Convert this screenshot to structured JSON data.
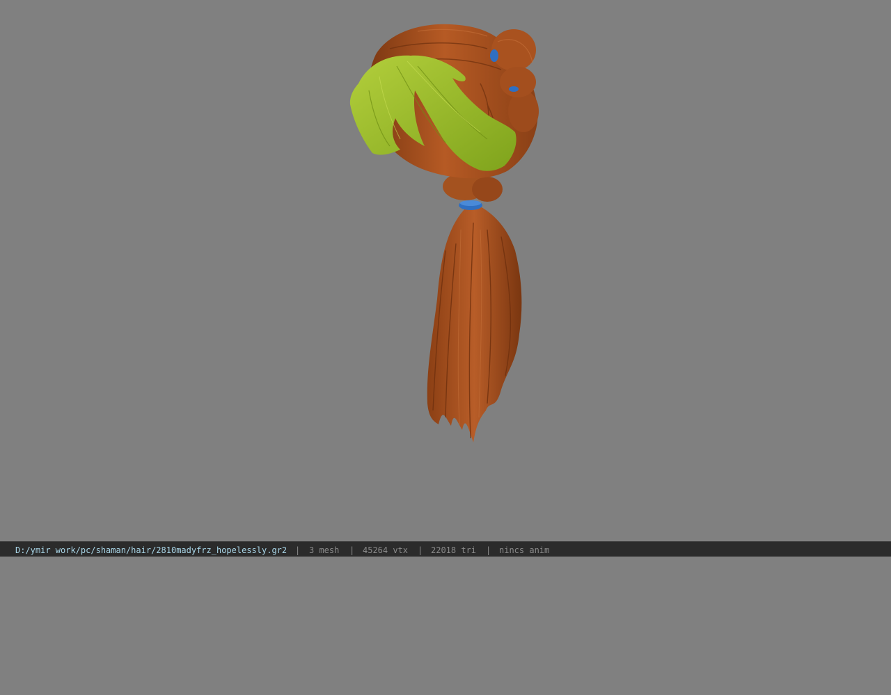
{
  "viewer": {
    "background_color": "#808080",
    "model": {
      "description": "hair",
      "colors": {
        "hair": "#a8501f",
        "fringe": "#9dbb2a",
        "ties": "#2f6fc2"
      }
    }
  },
  "status_bar": {
    "file_path": "D:/ymir work/pc/shaman/hair/2810madyfrz_hopelessly.gr2",
    "mesh_count": "3 mesh",
    "vertex_count": "45264 vtx",
    "triangle_count": "22018 tri",
    "animation": "nincs anim",
    "separator": "|"
  }
}
